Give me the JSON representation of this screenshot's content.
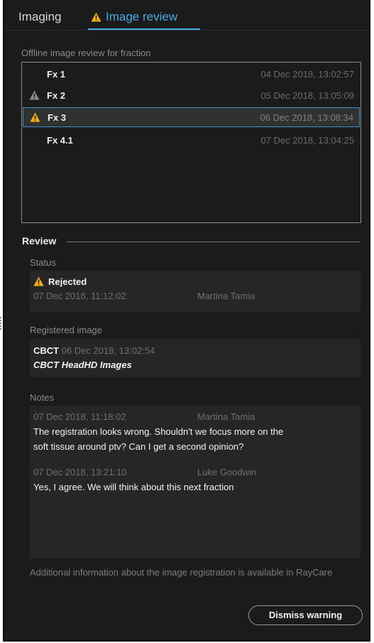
{
  "tabs": {
    "imaging": "Imaging",
    "image_review": "Image review"
  },
  "fraction_list": {
    "label": "Offline image review for fraction",
    "items": [
      {
        "name": "Fx 1",
        "date": "04 Dec 2018, 13:02:57",
        "icon": "none"
      },
      {
        "name": "Fx 2",
        "date": "05 Dec 2018, 13:05:09",
        "icon": "warning-icon-gray"
      },
      {
        "name": "Fx 3",
        "date": "06 Dec 2018, 13:08:34",
        "icon": "warning-icon-yellow"
      },
      {
        "name": "Fx 4.1",
        "date": "07 Dec 2018, 13:04:25",
        "icon": "none"
      }
    ]
  },
  "review": {
    "title": "Review",
    "status": {
      "label": "Status",
      "value": "Rejected",
      "date": "07 Dec 2018, 11:12:02",
      "user": "Martina Tamia"
    },
    "registered_image": {
      "label": "Registered image",
      "modality": "CBCT",
      "date": "06 Dec 2018, 13:02:54",
      "series": "CBCT HeadHD Images"
    },
    "notes": {
      "label": "Notes",
      "entries": [
        {
          "date": "07 Dec 2018, 11:18:02",
          "user": "Martina Tamia",
          "line1": "The registration looks wrong. Shouldn't we focus more on the",
          "line2": "soft tissue around ptv? Can I get a second opinion?"
        },
        {
          "date": "07 Dec 2018, 13:21:10",
          "user": "Luke Goodwin",
          "line1": "Yes, I agree. We will think about this next fraction"
        }
      ]
    }
  },
  "footer": {
    "info": "Additional information about the image registration is available in RayCare",
    "dismiss_label": "Dismiss warning"
  },
  "colors": {
    "background": "#1b1b1b",
    "accent": "#4aa8e6",
    "warning": "#f2b01e",
    "warning_inactive": "#8a8a8a"
  }
}
